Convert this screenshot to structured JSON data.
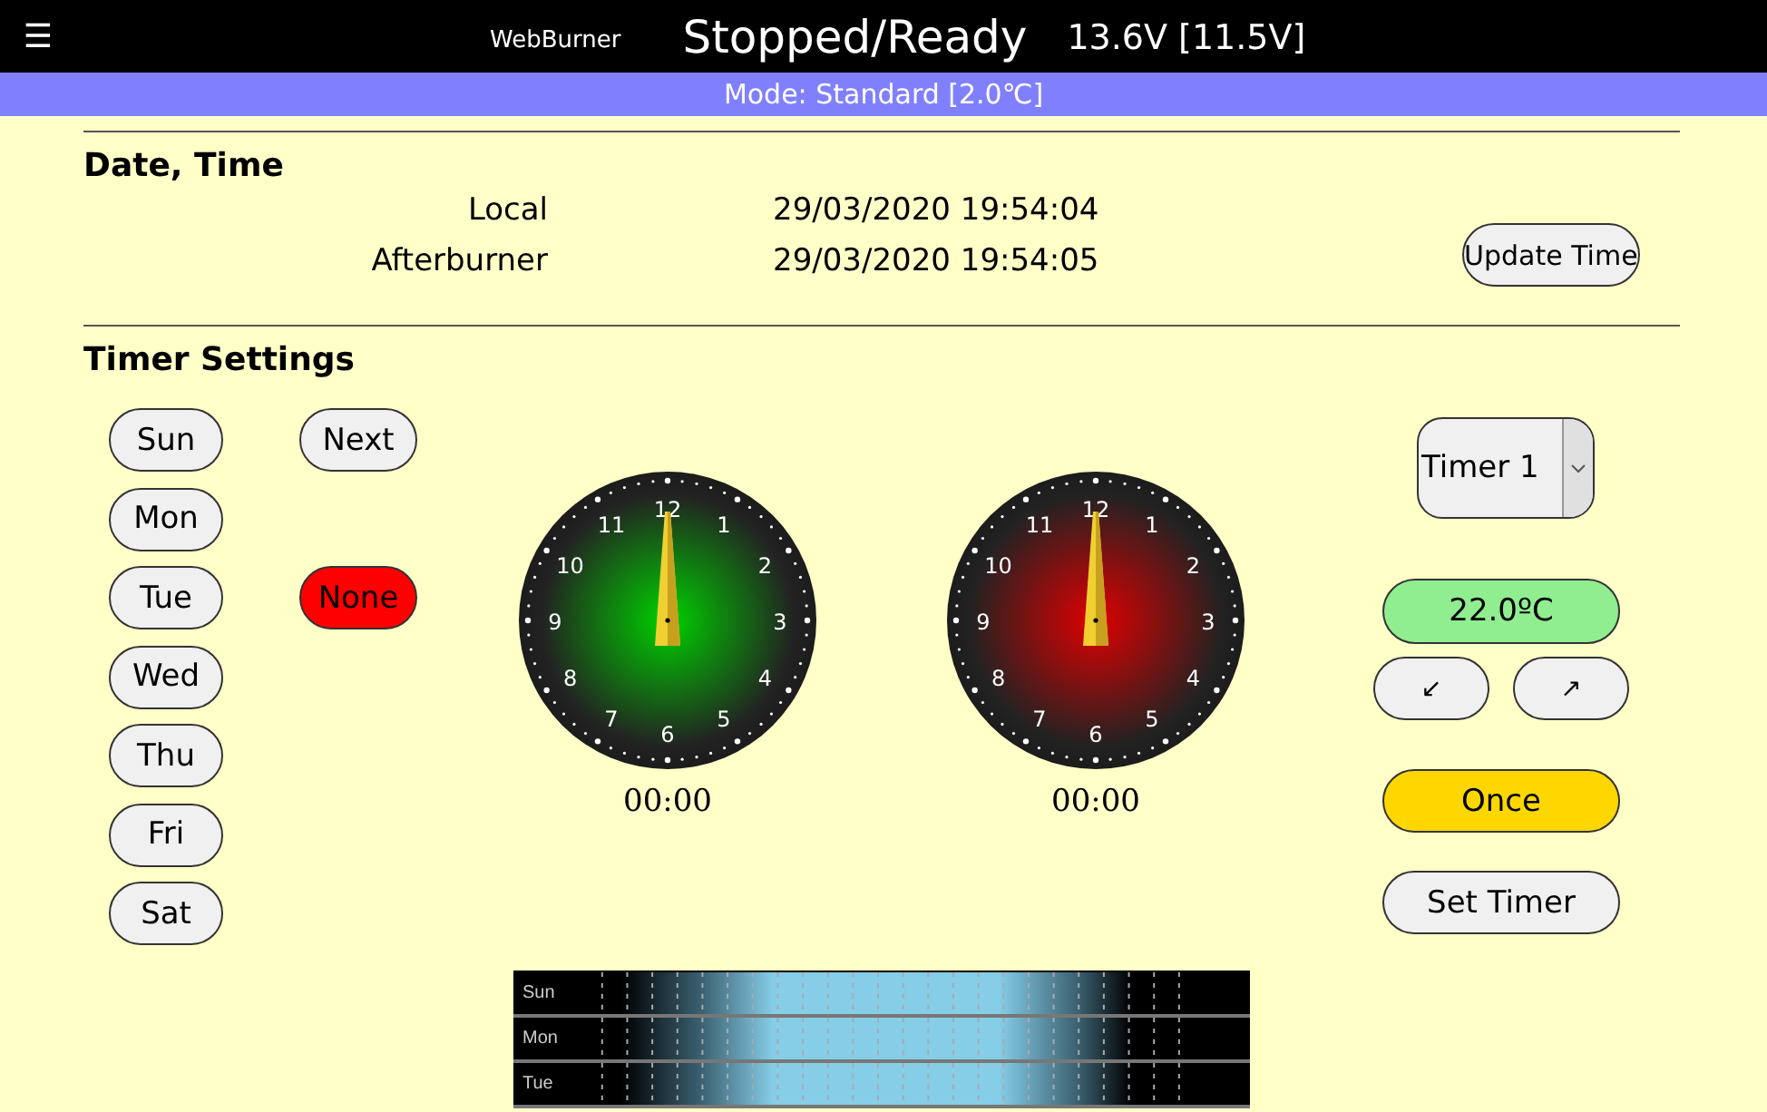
{
  "header": {
    "menu_icon": "☰",
    "app_name": "WebBurner",
    "status": "Stopped/Ready",
    "voltage": "13.6V [11.5V]"
  },
  "mode_bar": "Mode: Standard [2.0℃]",
  "date_time": {
    "heading": "Date, Time",
    "rows": [
      {
        "label": "Local",
        "value": "29/03/2020 19:54:04"
      },
      {
        "label": "Afterburner",
        "value": "29/03/2020 19:54:05"
      }
    ],
    "button": "Update Time"
  },
  "timer_settings": {
    "heading": "Timer Settings",
    "days": [
      {
        "label": "Sun",
        "selected": false
      },
      {
        "label": "Mon",
        "selected": false
      },
      {
        "label": "Tue",
        "selected": false
      },
      {
        "label": "Wed",
        "selected": false
      },
      {
        "label": "Thu",
        "selected": false
      },
      {
        "label": "Fri",
        "selected": false
      },
      {
        "label": "Sat",
        "selected": false
      }
    ],
    "day_buttons": [
      {
        "label": "Next",
        "on": false
      },
      {
        "label": "None",
        "on": true
      }
    ],
    "clocks": [
      {
        "kind": "start",
        "time": "00:00",
        "numerals": [
          "12",
          "1",
          "2",
          "3",
          "4",
          "5",
          "6",
          "7",
          "8",
          "9",
          "10",
          "11"
        ]
      },
      {
        "kind": "stop",
        "time": "00:00",
        "numerals": [
          "12",
          "1",
          "2",
          "3",
          "4",
          "5",
          "6",
          "7",
          "8",
          "9",
          "10",
          "11"
        ]
      }
    ],
    "timer_select": "Timer 1",
    "temperature": "22.0ºC",
    "arrows": [
      "↙",
      "↗"
    ],
    "repeat": {
      "label": "Once",
      "on": true
    },
    "set_button": "Set Timer"
  },
  "schedule": {
    "rows": [
      "Sun",
      "Mon",
      "Tue"
    ]
  }
}
